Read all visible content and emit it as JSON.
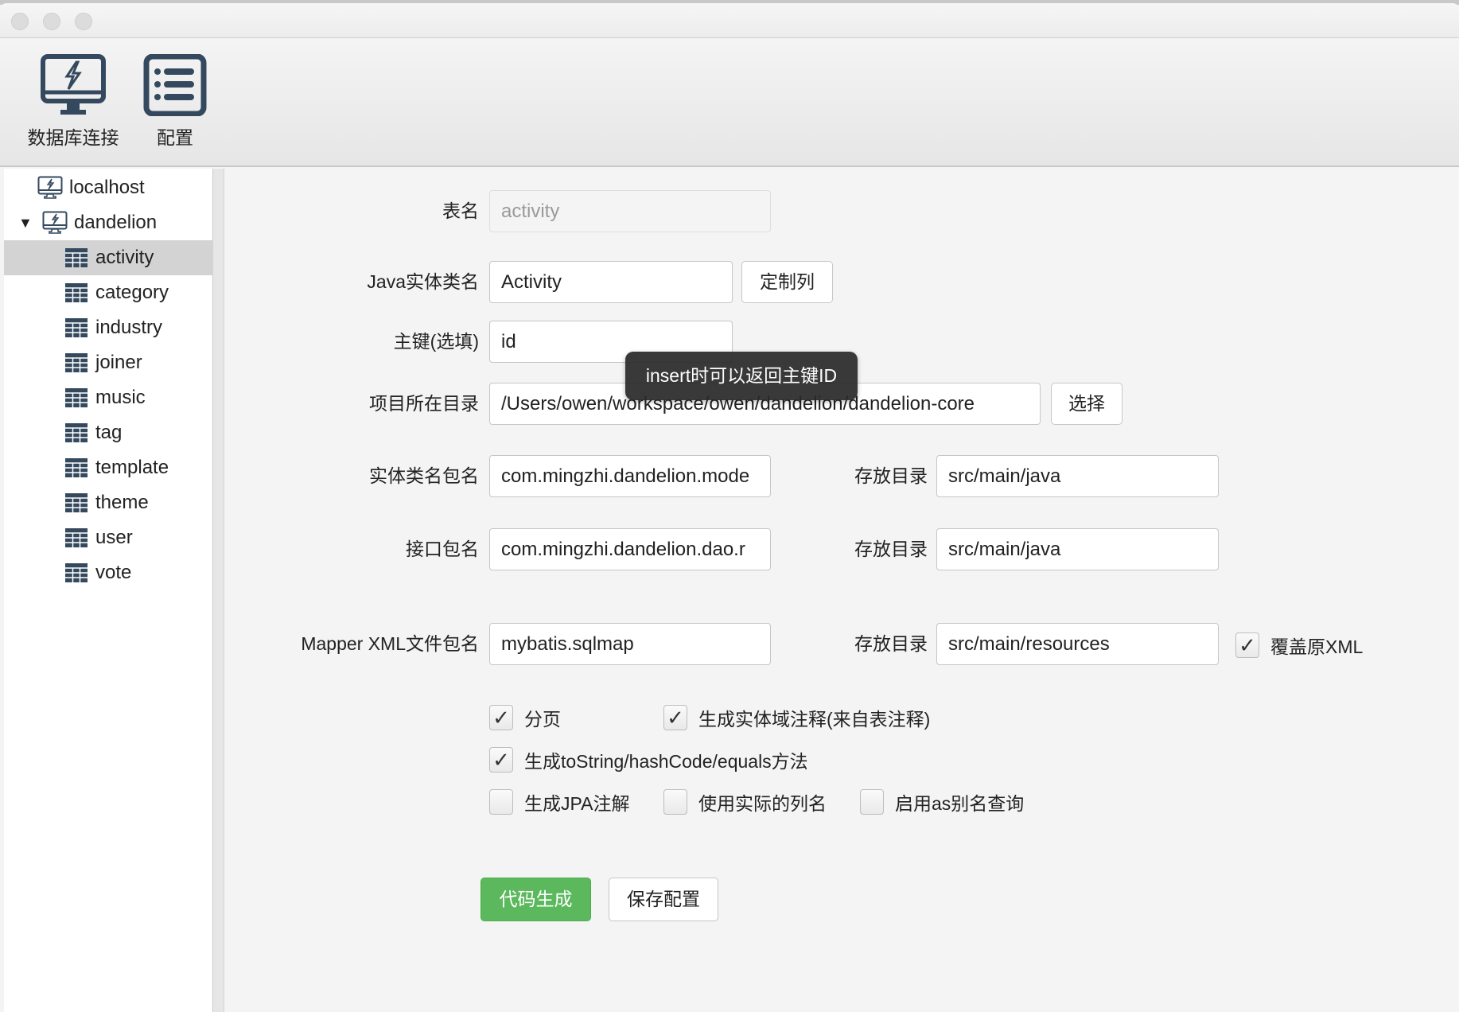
{
  "toolbar": {
    "db_connect": "数据库连接",
    "config": "配置"
  },
  "sidebar": {
    "connections": [
      {
        "label": "localhost",
        "expanded": false
      },
      {
        "label": "dandelion",
        "expanded": true
      }
    ],
    "tables": [
      "activity",
      "category",
      "industry",
      "joiner",
      "music",
      "tag",
      "template",
      "theme",
      "user",
      "vote"
    ],
    "selected": "activity"
  },
  "form": {
    "table_name_label": "表名",
    "table_name_value": "activity",
    "entity_label": "Java实体类名",
    "entity_value": "Activity",
    "custom_columns_button": "定制列",
    "pk_label": "主键(选填)",
    "pk_value": "id",
    "project_dir_label": "项目所在目录",
    "project_dir_value": "/Users/owen/workspace/owen/dandelion/dandelion-core",
    "choose_button": "选择",
    "entity_pkg_label": "实体类名包名",
    "entity_pkg_value": "com.mingzhi.dandelion.mode",
    "dao_pkg_label": "接口包名",
    "dao_pkg_value": "com.mingzhi.dandelion.dao.r",
    "mapper_pkg_label": "Mapper XML文件包名",
    "mapper_pkg_value": "mybatis.sqlmap",
    "store_dir_label": "存放目录",
    "entity_dir_value": "src/main/java",
    "dao_dir_value": "src/main/java",
    "mapper_dir_value": "src/main/resources",
    "overwrite_xml_label": "覆盖原XML",
    "overwrite_xml_checked": true
  },
  "options": [
    {
      "label": "分页",
      "checked": true
    },
    {
      "label": "生成实体域注释(来自表注释)",
      "checked": true
    },
    {
      "label": "生成toString/hashCode/equals方法",
      "checked": true
    },
    {
      "label": "生成JPA注解",
      "checked": false
    },
    {
      "label": "使用实际的列名",
      "checked": false
    },
    {
      "label": "启用as别名查询",
      "checked": false
    }
  ],
  "actions": {
    "generate": "代码生成",
    "save": "保存配置"
  },
  "tooltip": "insert时可以返回主键ID",
  "colors": {
    "accent": "#5cb85c",
    "icon": "#34495e"
  }
}
